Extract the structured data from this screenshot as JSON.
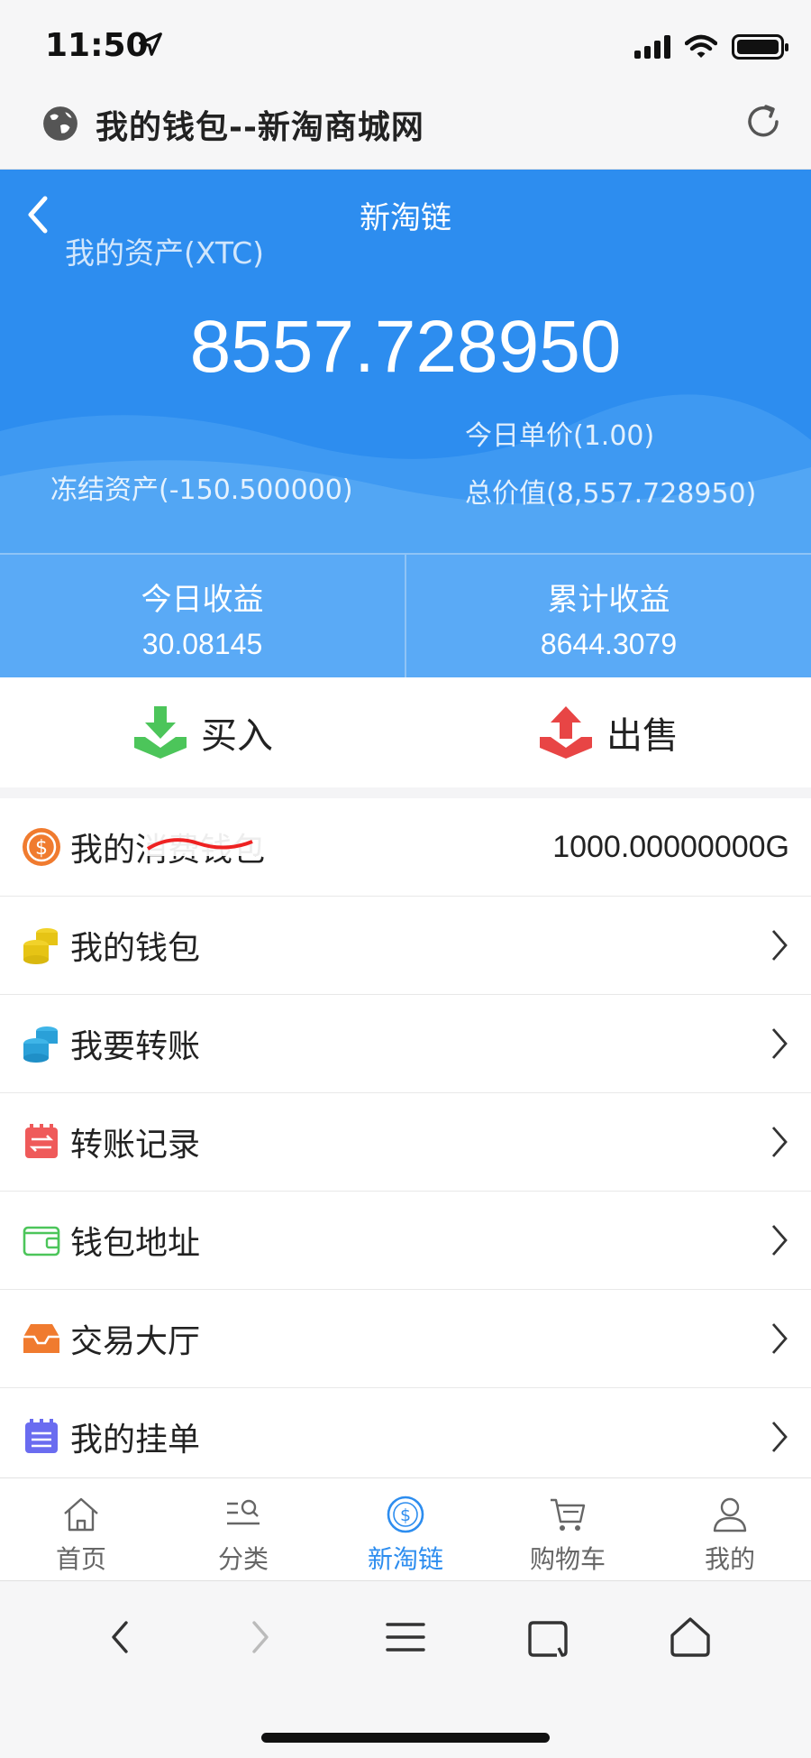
{
  "status_bar": {
    "time": "11:50"
  },
  "browser": {
    "title": "我的钱包--新淘商城网"
  },
  "header": {
    "title": "新淘链",
    "asset_label": "我的资产(XTC)",
    "asset_value": "8557.728950",
    "price_today": "今日单价(1.00)",
    "frozen": "冻结资产(-150.500000)",
    "total_value": "总价值(8,557.728950)"
  },
  "stats": [
    {
      "label": "今日收益",
      "value": "30.08145"
    },
    {
      "label": "累计收益",
      "value": "8644.3079"
    }
  ],
  "actions": {
    "buy": "买入",
    "sell": "出售"
  },
  "list": [
    {
      "label": "我的消费钱包",
      "value": "1000.00000000G",
      "icon": "dollar-coin-icon"
    },
    {
      "label": "我的钱包",
      "icon": "coins-stack-icon"
    },
    {
      "label": "我要转账",
      "icon": "database-icon"
    },
    {
      "label": "转账记录",
      "icon": "transfer-record-icon"
    },
    {
      "label": "钱包地址",
      "icon": "wallet-icon"
    },
    {
      "label": "交易大厅",
      "icon": "inbox-icon"
    },
    {
      "label": "我的挂单",
      "icon": "order-list-icon"
    }
  ],
  "tabbar": [
    {
      "label": "首页",
      "icon": "home-icon"
    },
    {
      "label": "分类",
      "icon": "category-icon"
    },
    {
      "label": "新淘链",
      "icon": "dollar-icon",
      "active": true
    },
    {
      "label": "购物车",
      "icon": "cart-icon"
    },
    {
      "label": "我的",
      "icon": "user-icon"
    }
  ],
  "colors": {
    "primary": "#2d8def",
    "stats_bg": "#5aaaf6",
    "buy": "#4cc55a",
    "sell": "#e84545"
  }
}
